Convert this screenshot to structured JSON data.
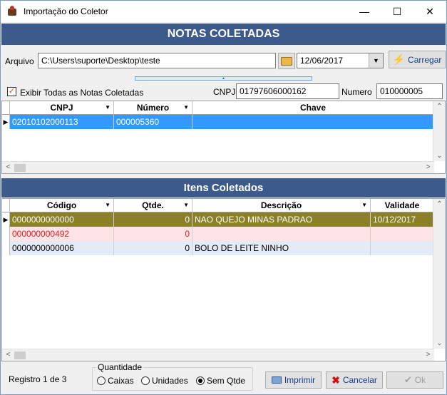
{
  "window": {
    "title": "Importação do Coletor"
  },
  "header": {
    "notas_title": "NOTAS COLETADAS",
    "itens_title": "Itens Coletados"
  },
  "file": {
    "label": "Arquivo",
    "path": "C:\\Users\\suporte\\Desktop\\teste",
    "date": "12/06/2017",
    "load_label": "Carregar"
  },
  "filter": {
    "show_all_label": "Exibir Todas as Notas Coletadas",
    "show_all_checked": true,
    "cnpj_label": "CNPJ",
    "cnpj_value": "01797606000162",
    "numero_label": "Numero",
    "numero_value": "010000005"
  },
  "notas_grid": {
    "columns": [
      "CNPJ",
      "Número",
      "Chave"
    ],
    "rows": [
      {
        "cnpj": "02010102000113",
        "numero": "000005360",
        "chave": ""
      }
    ]
  },
  "itens_grid": {
    "columns": [
      "Código",
      "Qtde.",
      "Descrição",
      "Validade"
    ],
    "rows": [
      {
        "codigo": "0000000000000",
        "qtde": "0",
        "descricao": "NAO QUEJO MINAS PADRAO",
        "validade": "10/12/2017"
      },
      {
        "codigo": "000000000492",
        "qtde": "0",
        "descricao": "",
        "validade": ""
      },
      {
        "codigo": "0000000000006",
        "qtde": "0",
        "descricao": "BOLO DE LEITE NINHO",
        "validade": ""
      }
    ]
  },
  "footer": {
    "record_text": "Registro 1 de 3",
    "quantity_group": "Quantidade",
    "options": [
      "Caixas",
      "Unidades",
      "Sem Qtde"
    ],
    "selected_option": "Sem Qtde",
    "print_label": "Imprimir",
    "cancel_label": "Cancelar",
    "ok_label": "Ok"
  },
  "colors": {
    "banner": "#3d5a8c",
    "selected_row": "#3399ff",
    "olive_row": "#8b7f27",
    "pink_row": "#fde3e6",
    "blue_row": "#e3ebf7"
  }
}
